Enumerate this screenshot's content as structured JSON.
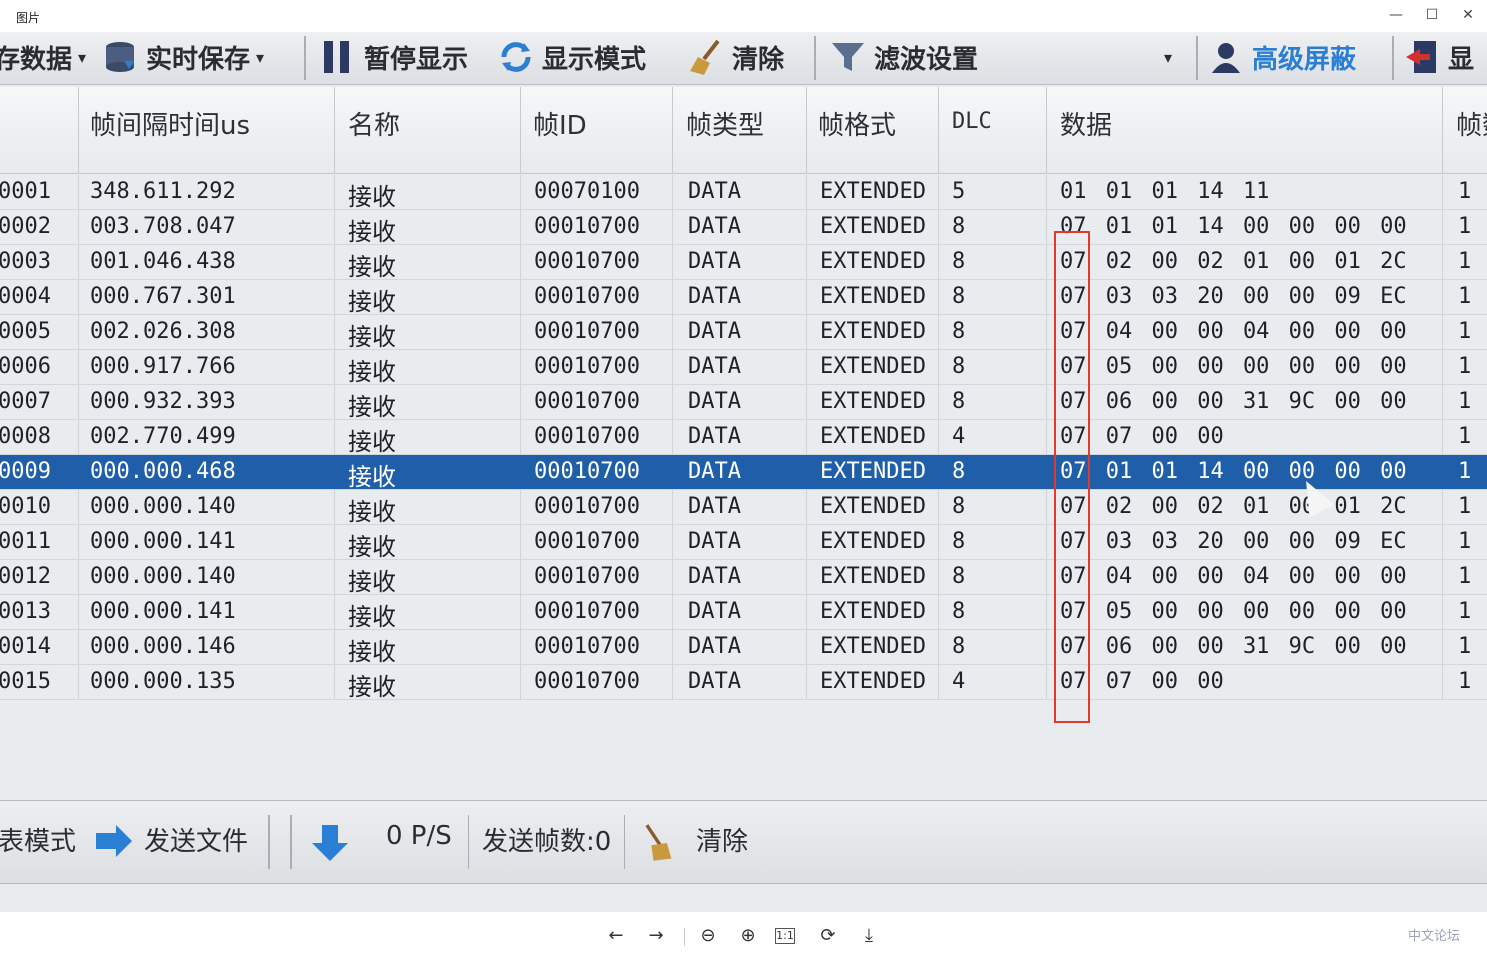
{
  "window": {
    "title": "图片",
    "minimize": "—",
    "maximize": "☐",
    "close": "✕"
  },
  "toolbar": {
    "items": [
      {
        "label": "存数据",
        "icon": "disk-icon"
      },
      {
        "label": "实时保存",
        "icon": "database-icon"
      },
      {
        "label": "暂停显示",
        "icon": "pause-icon"
      },
      {
        "label": "显示模式",
        "icon": "refresh-icon"
      },
      {
        "label": "清除",
        "icon": "broom-icon"
      },
      {
        "label": "滤波设置",
        "icon": "filter-icon"
      },
      {
        "label": "高级屏蔽",
        "icon": "shield-icon"
      },
      {
        "label": "显",
        "icon": "export-icon"
      }
    ],
    "dropdown_arrow": "▾"
  },
  "table": {
    "headers": [
      "帧间隔时间us",
      "名称",
      "帧ID",
      "帧类型",
      "帧格式",
      "DLC",
      "数据",
      "帧数"
    ],
    "rows": [
      {
        "seq": "0001",
        "interval": "348.611.292",
        "name": "接收",
        "id": "00070100",
        "type": "DATA",
        "format": "EXTENDED",
        "dlc": "5",
        "data": "01 01 01 14 11",
        "count": "1"
      },
      {
        "seq": "0002",
        "interval": "003.708.047",
        "name": "接收",
        "id": "00010700",
        "type": "DATA",
        "format": "EXTENDED",
        "dlc": "8",
        "data": "07 01 01 14 00 00 00 00",
        "count": "1"
      },
      {
        "seq": "0003",
        "interval": "001.046.438",
        "name": "接收",
        "id": "00010700",
        "type": "DATA",
        "format": "EXTENDED",
        "dlc": "8",
        "data": "07 02 00 02 01 00 01 2C",
        "count": "1"
      },
      {
        "seq": "0004",
        "interval": "000.767.301",
        "name": "接收",
        "id": "00010700",
        "type": "DATA",
        "format": "EXTENDED",
        "dlc": "8",
        "data": "07 03 03 20 00 00 09 EC",
        "count": "1"
      },
      {
        "seq": "0005",
        "interval": "002.026.308",
        "name": "接收",
        "id": "00010700",
        "type": "DATA",
        "format": "EXTENDED",
        "dlc": "8",
        "data": "07 04 00 00 04 00 00 00",
        "count": "1"
      },
      {
        "seq": "0006",
        "interval": "000.917.766",
        "name": "接收",
        "id": "00010700",
        "type": "DATA",
        "format": "EXTENDED",
        "dlc": "8",
        "data": "07 05 00 00 00 00 00 00",
        "count": "1"
      },
      {
        "seq": "0007",
        "interval": "000.932.393",
        "name": "接收",
        "id": "00010700",
        "type": "DATA",
        "format": "EXTENDED",
        "dlc": "8",
        "data": "07 06 00 00 31 9C 00 00",
        "count": "1"
      },
      {
        "seq": "0008",
        "interval": "002.770.499",
        "name": "接收",
        "id": "00010700",
        "type": "DATA",
        "format": "EXTENDED",
        "dlc": "4",
        "data": "07 07 00 00",
        "count": "1"
      },
      {
        "seq": "0009",
        "interval": "000.000.468",
        "name": "接收",
        "id": "00010700",
        "type": "DATA",
        "format": "EXTENDED",
        "dlc": "8",
        "data": "07 01 01 14 00 00 00 00",
        "count": "1"
      },
      {
        "seq": "0010",
        "interval": "000.000.140",
        "name": "接收",
        "id": "00010700",
        "type": "DATA",
        "format": "EXTENDED",
        "dlc": "8",
        "data": "07 02 00 02 01 00 01 2C",
        "count": "1"
      },
      {
        "seq": "0011",
        "interval": "000.000.141",
        "name": "接收",
        "id": "00010700",
        "type": "DATA",
        "format": "EXTENDED",
        "dlc": "8",
        "data": "07 03 03 20 00 00 09 EC",
        "count": "1"
      },
      {
        "seq": "0012",
        "interval": "000.000.140",
        "name": "接收",
        "id": "00010700",
        "type": "DATA",
        "format": "EXTENDED",
        "dlc": "8",
        "data": "07 04 00 00 04 00 00 00",
        "count": "1"
      },
      {
        "seq": "0013",
        "interval": "000.000.141",
        "name": "接收",
        "id": "00010700",
        "type": "DATA",
        "format": "EXTENDED",
        "dlc": "8",
        "data": "07 05 00 00 00 00 00 00",
        "count": "1"
      },
      {
        "seq": "0014",
        "interval": "000.000.146",
        "name": "接收",
        "id": "00010700",
        "type": "DATA",
        "format": "EXTENDED",
        "dlc": "8",
        "data": "07 06 00 00 31 9C 00 00",
        "count": "1"
      },
      {
        "seq": "0015",
        "interval": "000.000.135",
        "name": "接收",
        "id": "00010700",
        "type": "DATA",
        "format": "EXTENDED",
        "dlc": "4",
        "data": "07 07 00 00",
        "count": "1"
      }
    ],
    "selected_row": "0009"
  },
  "bottombar": {
    "mode_label": "表模式",
    "send_file": "发送文件",
    "rate": "0 P/S",
    "sent_frames": "发送帧数:0",
    "clear": "清除"
  },
  "viewer": {
    "buttons": [
      "←",
      "→",
      "⊖",
      "⊕",
      "1:1",
      "⟳",
      "⤓"
    ]
  },
  "watermark": "中文论坛",
  "colors": {
    "selection": "#1f5ea9",
    "highlight_box": "#e03a2e",
    "accent_blue": "#2a7fd4"
  }
}
